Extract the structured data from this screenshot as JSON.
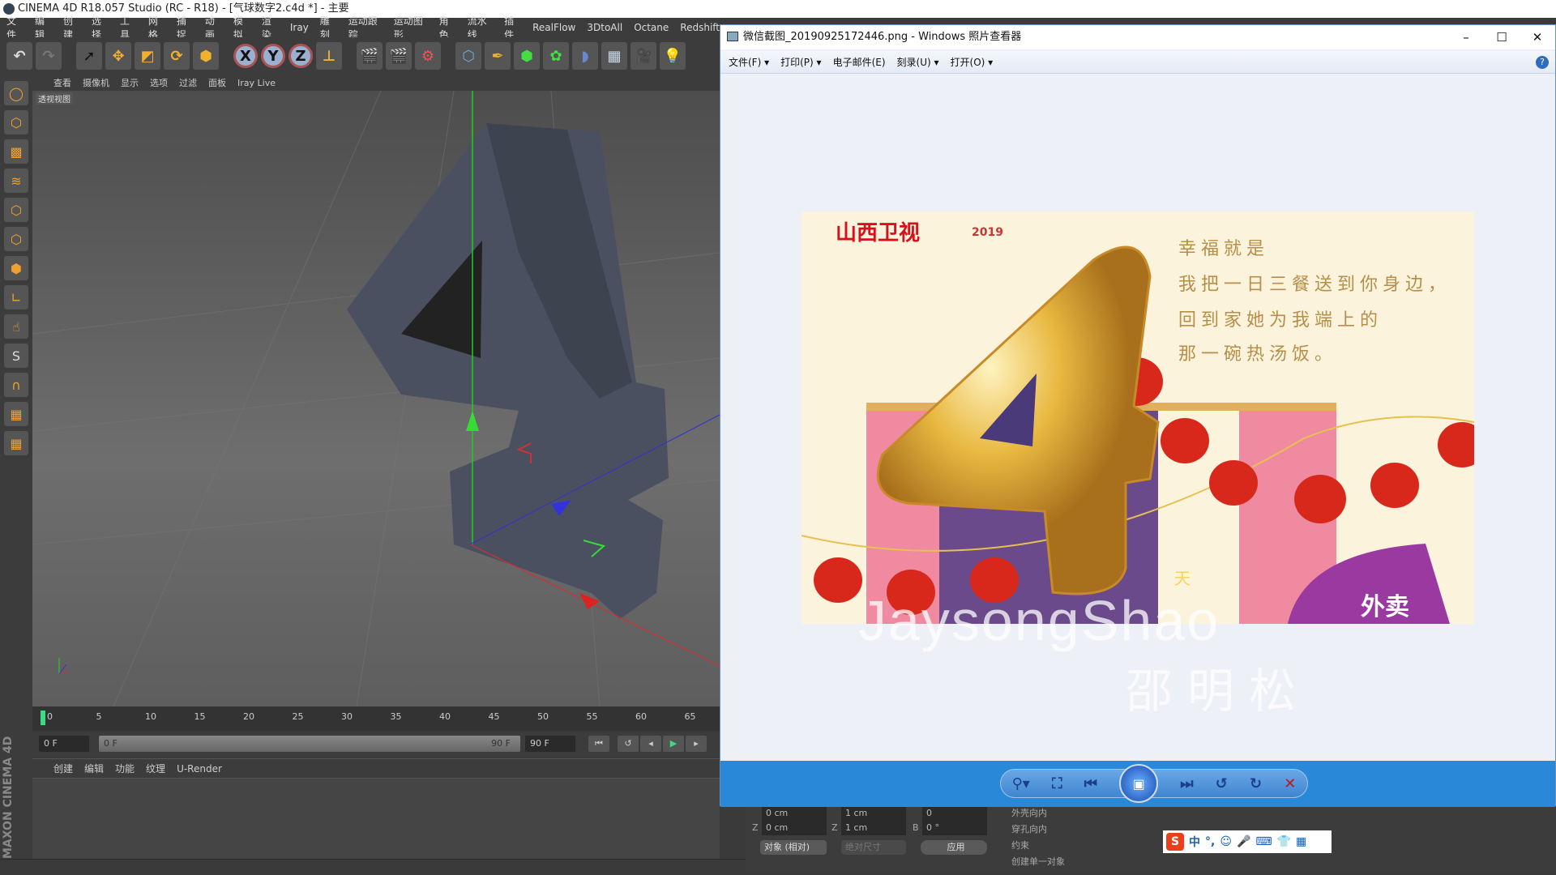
{
  "app_title": "CINEMA 4D R18.057 Studio (RC - R18) - [气球数字2.c4d *] - 主要",
  "menu": [
    "文件",
    "编辑",
    "创建",
    "选择",
    "工具",
    "网格",
    "捕捉",
    "动画",
    "模拟",
    "渲染",
    "Iray",
    "雕刻",
    "运动跟踪",
    "运动图形",
    "角色",
    "流水线",
    "插件",
    "RealFlow",
    "3DtoAll",
    "Octane",
    "Redshift"
  ],
  "toolbar": {
    "x_label": "X",
    "y_label": "Y",
    "z_label": "Z"
  },
  "viewport": {
    "menu": [
      "查看",
      "摄像机",
      "显示",
      "选项",
      "过滤",
      "面板",
      "Iray Live"
    ],
    "label": "透视视图"
  },
  "timeline": {
    "ticks": [
      "0",
      "5",
      "10",
      "15",
      "20",
      "25",
      "30",
      "35",
      "40",
      "45",
      "50",
      "55",
      "60",
      "65"
    ],
    "start_field": "0 F",
    "range_start": "0 F",
    "range_end": "90 F",
    "end_field": "90 F",
    "current_frame": 0
  },
  "material": {
    "menu": [
      "创建",
      "编辑",
      "功能",
      "纹理",
      "U-Render"
    ]
  },
  "brand": "MAXON CINEMA 4D",
  "attributes": {
    "row1": [
      "0 cm",
      "1 cm",
      "0"
    ],
    "z_label": "Z",
    "z_pos": "0 cm",
    "z_size": "1 cm",
    "b_label": "B",
    "b_val": "0 °",
    "mode": "对象 (相对)",
    "size_mode": "绝对尺寸",
    "apply": "应用",
    "options": [
      "外壳向内",
      "穿孔向内",
      "约束",
      "创建单一对象"
    ]
  },
  "ime": {
    "logo": "S",
    "items": [
      "中",
      "°,",
      "☺",
      "🎤",
      "⌨",
      "👕",
      "▦"
    ]
  },
  "viewer": {
    "title": "微信截图_20190925172446.png - Windows 照片查看器",
    "menu": [
      "文件(F) ▾",
      "打印(P) ▾",
      "电子邮件(E)",
      "刻录(U) ▾",
      "打开(O) ▾"
    ],
    "help": "?",
    "photo": {
      "logo": "山西卫视",
      "logo2": "2019",
      "poem": [
        "幸福就是",
        "我把一日三餐送到你身边，",
        "回到家她为我端上的",
        "那一碗热汤饭。"
      ],
      "big_number": "4",
      "tag": "外卖",
      "tag2": "天"
    },
    "watermark": [
      "JaysongShao",
      "邵明松"
    ],
    "controls": [
      "zoom-icon",
      "fit-icon",
      "previous-icon",
      "slideshow-icon",
      "next-icon",
      "rotate-ccw-icon",
      "rotate-cw-icon",
      "delete-icon"
    ]
  },
  "colors": {
    "c4d_bg": "#3c3c3c",
    "viewer_bar": "#2a88d8",
    "timeline_marker": "#3ddc84",
    "gold": "#e8b840",
    "lantern": "#d8281c"
  }
}
